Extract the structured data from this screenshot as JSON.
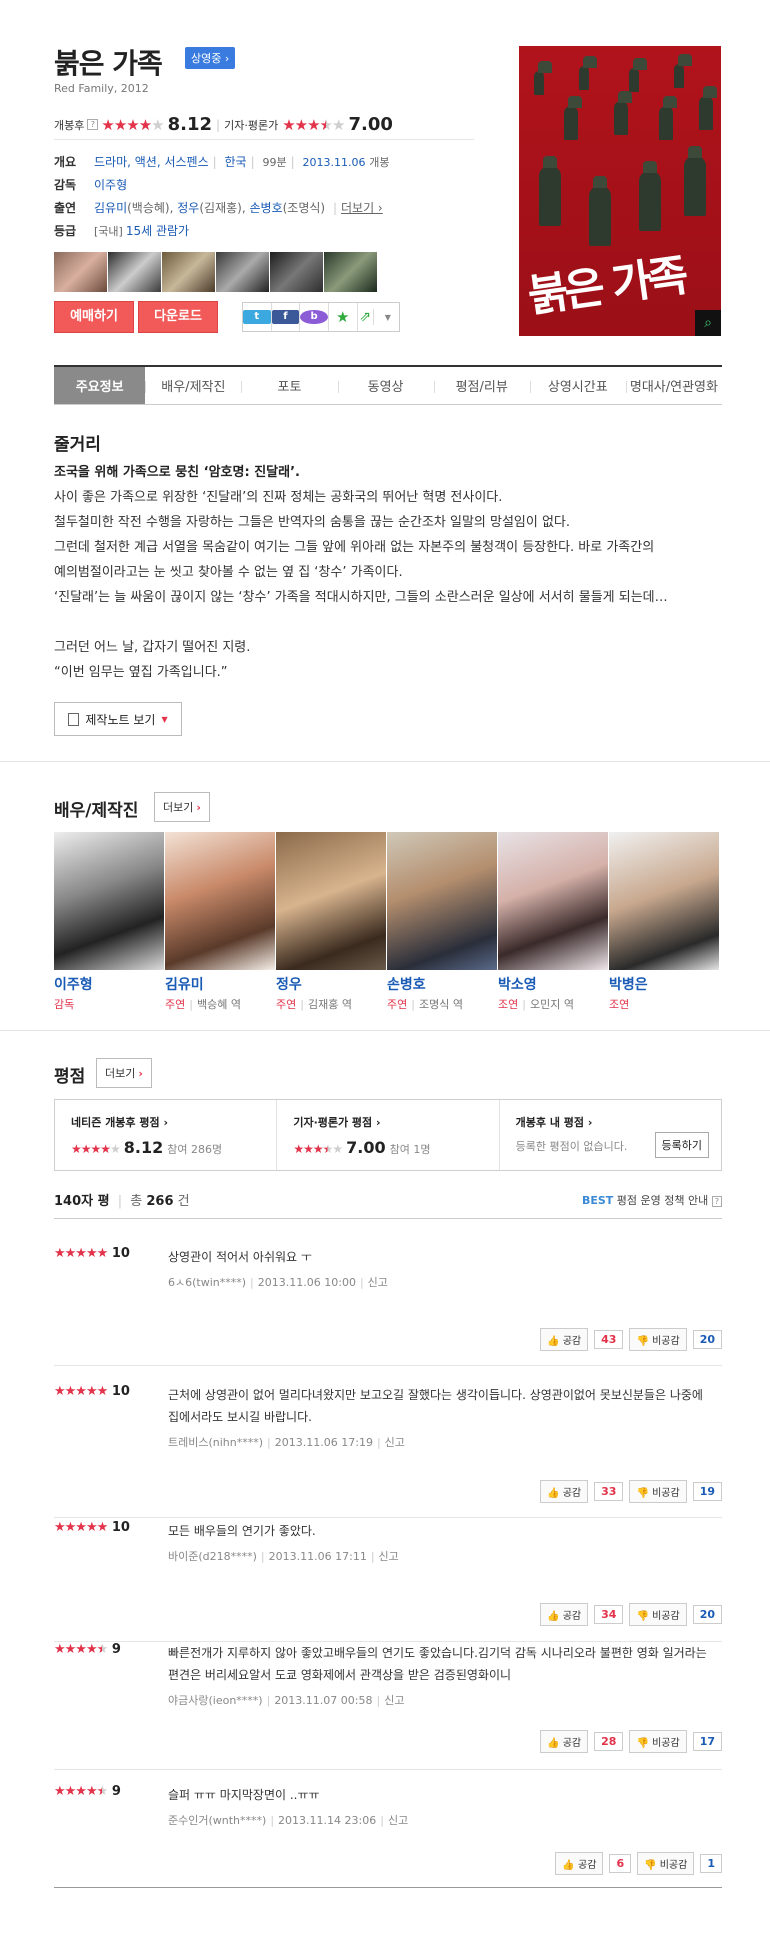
{
  "header": {
    "title": "붉은 가족",
    "badge": "상영중 ›",
    "subtitle": "Red Family, 2012",
    "netizen_label": "개봉후",
    "netizen_score": "8.12",
    "netizen_stars": 4,
    "critic_label": "기자·평론가",
    "critic_score": "7.00",
    "critic_stars": 3.5
  },
  "info": {
    "overview_label": "개요",
    "genres": "드라마, 액션, 서스펜스",
    "country": "한국",
    "runtime": "99분",
    "release_date": "2013.11.06",
    "release_suffix": "개봉",
    "director_label": "감독",
    "director": "이주형",
    "cast_label": "출연",
    "cast_1": "김유미",
    "cast_1_role": "(백승혜),",
    "cast_2": "정우",
    "cast_2_role": "(김재홍),",
    "cast_3": "손병호",
    "cast_3_role": "(조명식)",
    "cast_more": "더보기 ›",
    "grade_label": "등급",
    "grade_region": "[국내]",
    "grade": "15세 관람가"
  },
  "actions": {
    "buy_ticket": "예매하기",
    "download": "다운로드"
  },
  "tabs": [
    "주요정보",
    "배우/제작진",
    "포토",
    "동영상",
    "평점/리뷰",
    "상영시간표",
    "명대사/연관영화"
  ],
  "synopsis": {
    "heading": "줄거리",
    "lead": "조국을 위해 가족으로 뭉친 ‘암호명: 진달래’.",
    "lines": [
      "사이 좋은 가족으로 위장한 ‘진달래’의 진짜 정체는 공화국의 뛰어난 혁명 전사이다.",
      " 철두철미한 작전 수행을 자랑하는 그들은 반역자의 숨통을 끊는 순간조차 일말의 망설임이 없다.",
      " 그런데 철저한 계급 서열을 목숨같이 여기는 그들 앞에 위아래 없는 자본주의 불청객이 등장한다. 바로 가족간의",
      "예의범절이라고는 눈 씻고 찾아볼 수 없는 옆 집 ‘창수’ 가족이다.",
      " ‘진달래’는 늘 싸움이 끊이지 않는 ‘창수’ 가족을 적대시하지만, 그들의 소란스러운 일상에 서서히 물들게 되는데…",
      "",
      " 그러던 어느 날, 갑자기 떨어진 지령.",
      " “이번 임무는 옆집 가족입니다.”"
    ],
    "note_button": "제작노트 보기"
  },
  "cast_section": {
    "heading": "배우/제작진",
    "more": "더보기",
    "people": [
      {
        "name": "이주형",
        "role": "감독",
        "character": ""
      },
      {
        "name": "김유미",
        "role": "주연",
        "character": "백승혜 역"
      },
      {
        "name": "정우",
        "role": "주연",
        "character": "김재홍 역"
      },
      {
        "name": "손병호",
        "role": "주연",
        "character": "조명식 역"
      },
      {
        "name": "박소영",
        "role": "조연",
        "character": "오민지 역"
      },
      {
        "name": "박병은",
        "role": "조연",
        "character": ""
      }
    ]
  },
  "ratings": {
    "heading": "평점",
    "more": "더보기",
    "netizen_title": "네티즌 개봉후 평점 ›",
    "netizen_score": "8.12",
    "netizen_count": "참여 286명",
    "critic_title": "기자·평론가 평점 ›",
    "critic_score": "7.00",
    "critic_count": "참여 1명",
    "my_title": "개봉후 내 평점 ›",
    "my_empty": "등록한 평점이 없습니다.",
    "register": "등록하기",
    "tab_label": "140자 평",
    "total_label": "총",
    "total": "266",
    "total_unit": "건",
    "best_label": "BEST",
    "policy": "평점 운영 정책 안내",
    "like_label": "공감",
    "dislike_label": "비공감",
    "report": "신고"
  },
  "reviews": [
    {
      "score": "10",
      "stars": 5,
      "text": "상영관이 적어서 아쉬워요 ㅜ",
      "author": "6ㅅ6(twin****)",
      "date": "2013.11.06 10:00",
      "likes": "43",
      "dislikes": "20"
    },
    {
      "score": "10",
      "stars": 5,
      "text": "근처에 상영관이 없어 멀리다녀왔지만 보고오길 잘했다는 생각이듭니다. 상영관이없어 못보신분들은 나중에 집에서라도 보시길 바랍니다.",
      "author": "트레비스(nihn****)",
      "date": "2013.11.06 17:19",
      "likes": "33",
      "dislikes": "19"
    },
    {
      "score": "10",
      "stars": 5,
      "text": "모든 배우들의 연기가 좋았다.",
      "author": "바이준(d218****)",
      "date": "2013.11.06 17:11",
      "likes": "34",
      "dislikes": "20"
    },
    {
      "score": "9",
      "stars": 4.5,
      "text": "빠른전개가 지루하지 않아 좋았고배우들의 연기도 좋았습니다.김기덕 감독 시나리오라 불편한 영화 일거라는편견은 버리세요알서 도쿄 영화제에서 관객상을 받은 검증된영화이니",
      "author": "야금사랑(ieon****)",
      "date": "2013.11.07 00:58",
      "likes": "28",
      "dislikes": "17"
    },
    {
      "score": "9",
      "stars": 4.5,
      "text": "슬퍼 ㅠㅠ 마지막장면이 ..ㅠㅠ",
      "author": "준수인거(wnth****)",
      "date": "2013.11.14 23:06",
      "likes": "6",
      "dislikes": "1"
    }
  ],
  "colors": {
    "accent_red": "#e2334a",
    "link_blue": "#1a5bb5",
    "button_red": "#f25a5a"
  }
}
